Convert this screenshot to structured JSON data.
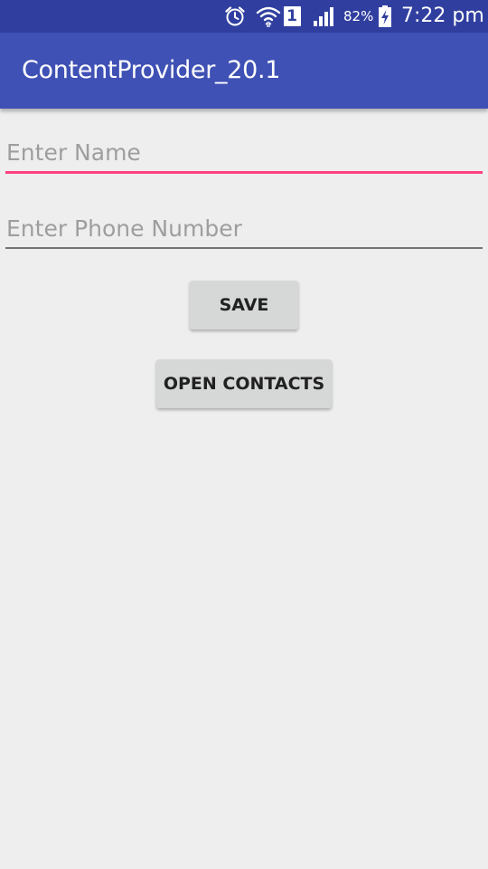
{
  "status_bar": {
    "battery_percent": "82%",
    "time": "7:22 pm",
    "sim_number": "1",
    "icons": [
      "alarm-icon",
      "wifi-icon",
      "sim-1-icon",
      "signal-icon",
      "battery-charging-icon"
    ]
  },
  "app_bar": {
    "title": "ContentProvider_20.1"
  },
  "form": {
    "name_placeholder": "Enter Name",
    "name_value": "",
    "phone_placeholder": "Enter Phone Number",
    "phone_value": "",
    "save_label": "SAVE",
    "open_contacts_label": "OPEN CONTACTS"
  },
  "colors": {
    "status_bar": "#303f9f",
    "app_bar": "#3f51b5",
    "accent": "#ff4081",
    "background": "#eeeeee",
    "button": "#d6d7d7"
  }
}
